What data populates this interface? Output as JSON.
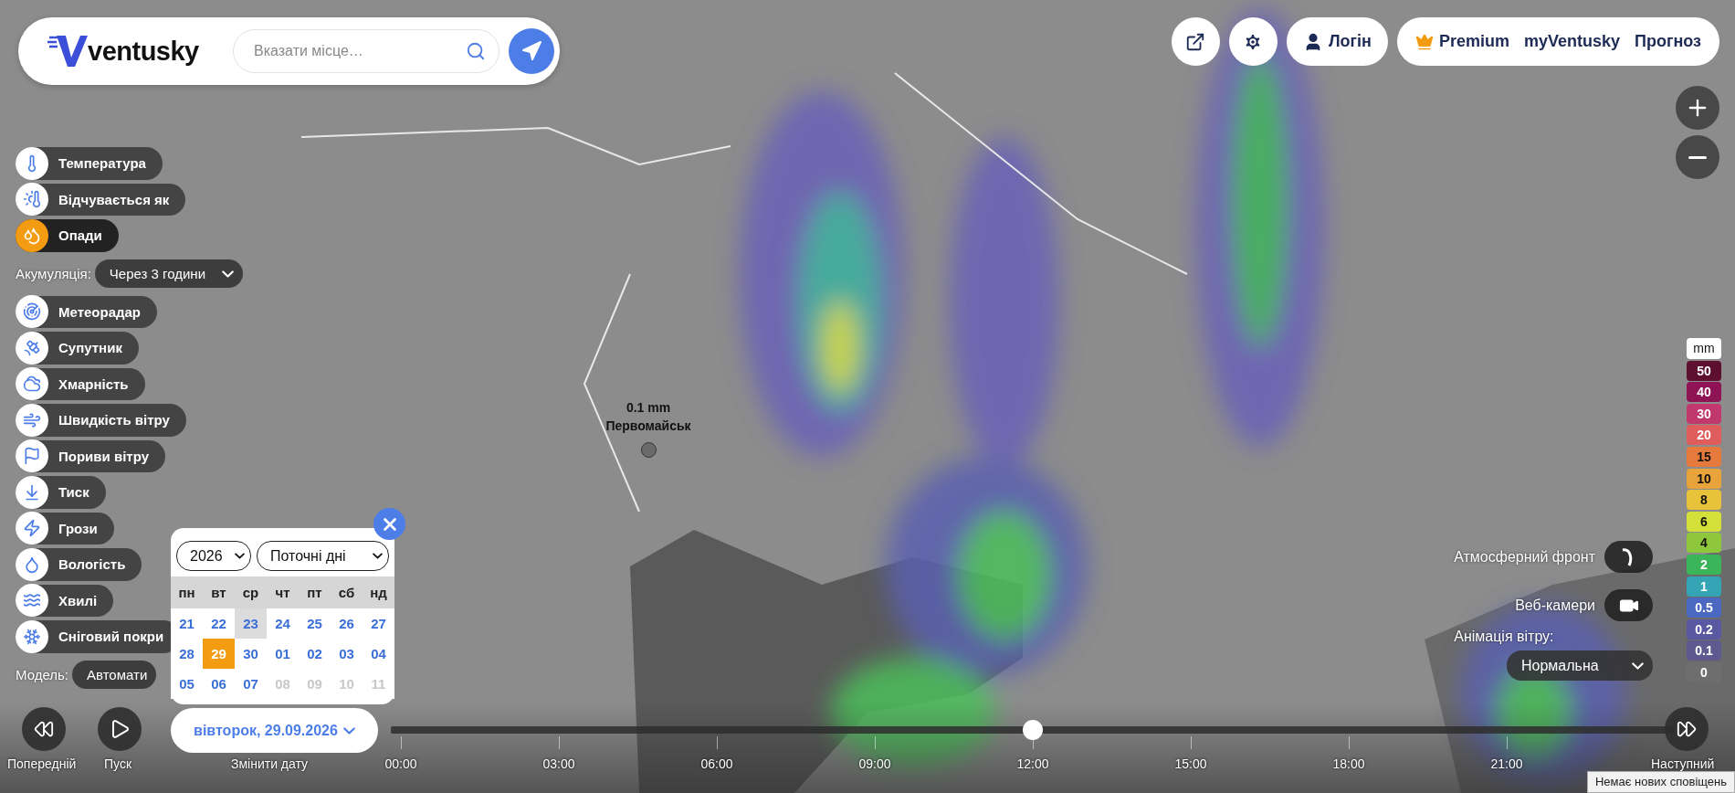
{
  "header": {
    "logo": "ventusky",
    "search": {
      "placeholder": "Вказати місце…"
    }
  },
  "top_actions": {
    "login": "Логін",
    "links": [
      {
        "label": "Premium",
        "kind": "premium"
      },
      {
        "label": "myVentusky",
        "kind": "link"
      },
      {
        "label": "Прогноз",
        "kind": "link"
      }
    ]
  },
  "layers": [
    {
      "label": "Температура",
      "kind": "temperature",
      "selected": false
    },
    {
      "label": "Відчувається як",
      "kind": "feels_like",
      "selected": false
    },
    {
      "label": "Опади",
      "kind": "precipitation",
      "selected": true
    },
    {
      "label": "Метеорадар",
      "kind": "radar",
      "selected": false
    },
    {
      "label": "Супутник",
      "kind": "satellite",
      "selected": false
    },
    {
      "label": "Хмарність",
      "kind": "clouds",
      "selected": false
    },
    {
      "label": "Швидкість вітру",
      "kind": "wind_speed",
      "selected": false
    },
    {
      "label": "Пориви вітру",
      "kind": "wind_gusts",
      "selected": false
    },
    {
      "label": "Тиск",
      "kind": "pressure",
      "selected": false
    },
    {
      "label": "Грози",
      "kind": "storms",
      "selected": false
    },
    {
      "label": "Вологість",
      "kind": "humidity",
      "selected": false
    },
    {
      "label": "Хвилі",
      "kind": "waves",
      "selected": false
    },
    {
      "label": "Сніговий покри",
      "kind": "snow",
      "selected": false
    }
  ],
  "accumulation": {
    "label": "Акумуляція:",
    "value": "Через 3 години"
  },
  "model": {
    "label": "Модель:",
    "value": "Автомати"
  },
  "calendar": {
    "year": "2026",
    "period": "Поточні дні",
    "weekdays": [
      "пн",
      "вт",
      "ср",
      "чт",
      "пт",
      "сб",
      "нд"
    ],
    "weeks": [
      [
        {
          "day": "21",
          "selected": false,
          "today": false,
          "disabled": false
        },
        {
          "day": "22",
          "selected": false,
          "today": false,
          "disabled": false
        },
        {
          "day": "23",
          "selected": false,
          "today": true,
          "disabled": false
        },
        {
          "day": "24",
          "selected": false,
          "today": false,
          "disabled": false
        },
        {
          "day": "25",
          "selected": false,
          "today": false,
          "disabled": false
        },
        {
          "day": "26",
          "selected": false,
          "today": false,
          "disabled": false
        },
        {
          "day": "27",
          "selected": false,
          "today": false,
          "disabled": false
        }
      ],
      [
        {
          "day": "28",
          "selected": false,
          "today": false,
          "disabled": false
        },
        {
          "day": "29",
          "selected": true,
          "today": false,
          "disabled": false
        },
        {
          "day": "30",
          "selected": false,
          "today": false,
          "disabled": false
        },
        {
          "day": "01",
          "selected": false,
          "today": false,
          "disabled": false
        },
        {
          "day": "02",
          "selected": false,
          "today": false,
          "disabled": false
        },
        {
          "day": "03",
          "selected": false,
          "today": false,
          "disabled": false
        },
        {
          "day": "04",
          "selected": false,
          "today": false,
          "disabled": false
        }
      ],
      [
        {
          "day": "05",
          "selected": false,
          "today": false,
          "disabled": false
        },
        {
          "day": "06",
          "selected": false,
          "today": false,
          "disabled": false
        },
        {
          "day": "07",
          "selected": false,
          "today": false,
          "disabled": false
        },
        {
          "day": "08",
          "selected": false,
          "today": false,
          "disabled": true
        },
        {
          "day": "09",
          "selected": false,
          "today": false,
          "disabled": true
        },
        {
          "day": "10",
          "selected": false,
          "today": false,
          "disabled": true
        },
        {
          "day": "11",
          "selected": false,
          "today": false,
          "disabled": true
        }
      ]
    ]
  },
  "date_button": "вівторок, 29.09.2026",
  "marker": {
    "value": "0.1 mm",
    "place": "Первомайськ"
  },
  "timeline": {
    "previous": "Попередній",
    "play": "Пуск",
    "change_date": "Змінити дату",
    "next": "Наступний",
    "hours": [
      "00:00",
      "03:00",
      "06:00",
      "09:00",
      "12:00",
      "15:00",
      "18:00",
      "21:00"
    ],
    "level": 0.5
  },
  "right_panel": {
    "front": "Атмосферний фронт",
    "front_on": false,
    "webcams": "Веб-камери",
    "webcams_on": false,
    "wind_animation": {
      "label": "Анімація вітру:",
      "value": "Нормальна"
    }
  },
  "legend": {
    "unit": "mm",
    "steps": [
      {
        "label": "50",
        "color": "#5c0f2e"
      },
      {
        "label": "40",
        "color": "#8f1456"
      },
      {
        "label": "30",
        "color": "#c0386e"
      },
      {
        "label": "20",
        "color": "#e05d5d"
      },
      {
        "label": "15",
        "color": "#e67a3c"
      },
      {
        "label": "10",
        "color": "#e8a33a"
      },
      {
        "label": "8",
        "color": "#e8c23a"
      },
      {
        "label": "6",
        "color": "#d4e03a"
      },
      {
        "label": "4",
        "color": "#8ec63c"
      },
      {
        "label": "2",
        "color": "#3cb45a"
      },
      {
        "label": "1",
        "color": "#35a5b5"
      },
      {
        "label": "0.5",
        "color": "#4a68c0"
      },
      {
        "label": "0.2",
        "color": "#5a58a0"
      },
      {
        "label": "0.1",
        "color": "#5e5a90"
      },
      {
        "label": "0",
        "color": "#6e6e6e"
      }
    ]
  },
  "notification": "Немає нових сповіщень"
}
